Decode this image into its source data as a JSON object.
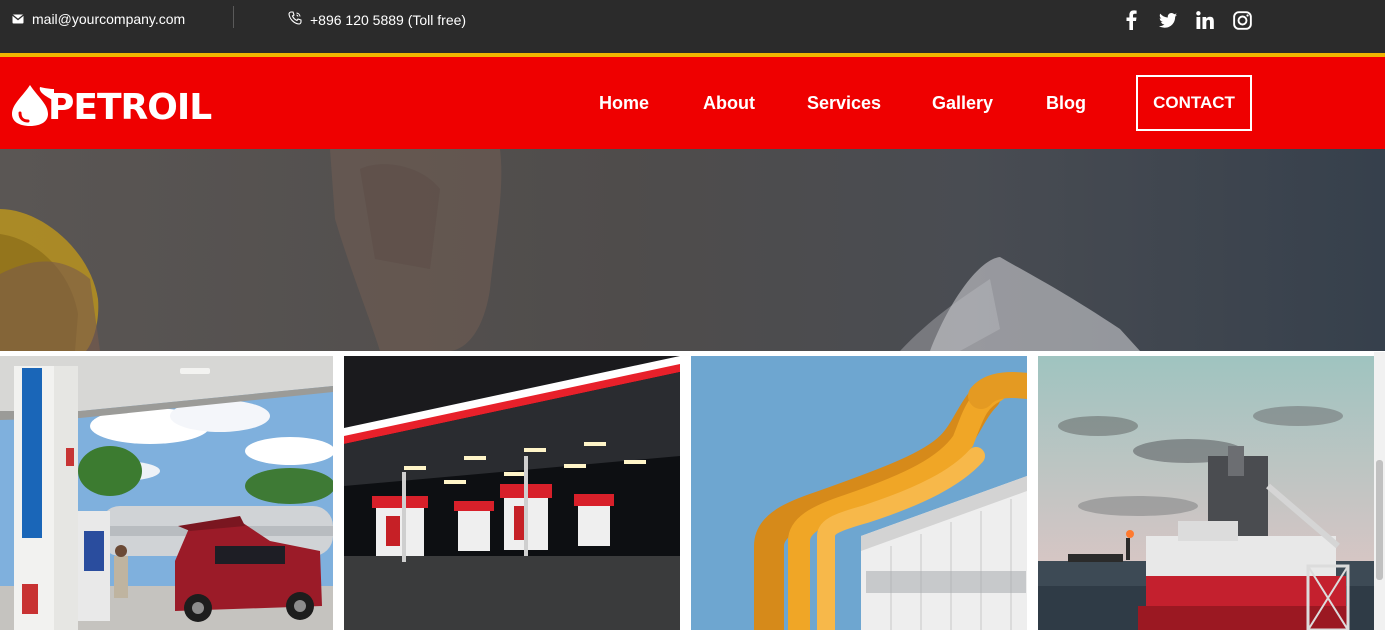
{
  "topbar": {
    "email": "mail@yourcompany.com",
    "phone": "+896 120 5889 (Toll free)",
    "email_icon": "envelope-icon",
    "phone_icon": "phone-icon",
    "socials": [
      "facebook-icon",
      "twitter-icon",
      "linkedin-icon",
      "instagram-icon"
    ]
  },
  "brand": {
    "name": "PETROIL",
    "logo_icon": "oil-drop-icon"
  },
  "nav": {
    "items": [
      "Home",
      "About",
      "Services",
      "Gallery",
      "Blog"
    ],
    "contact": "CONTACT"
  },
  "gallery": {
    "tiles": [
      "fuel-station-daylight",
      "fuel-station-night",
      "yellow-pipes-building",
      "offshore-vessel"
    ]
  },
  "colors": {
    "brand_red": "#ef0000",
    "topbar_dark": "#2b2b2b",
    "accent_stripe": "#f0b400"
  }
}
